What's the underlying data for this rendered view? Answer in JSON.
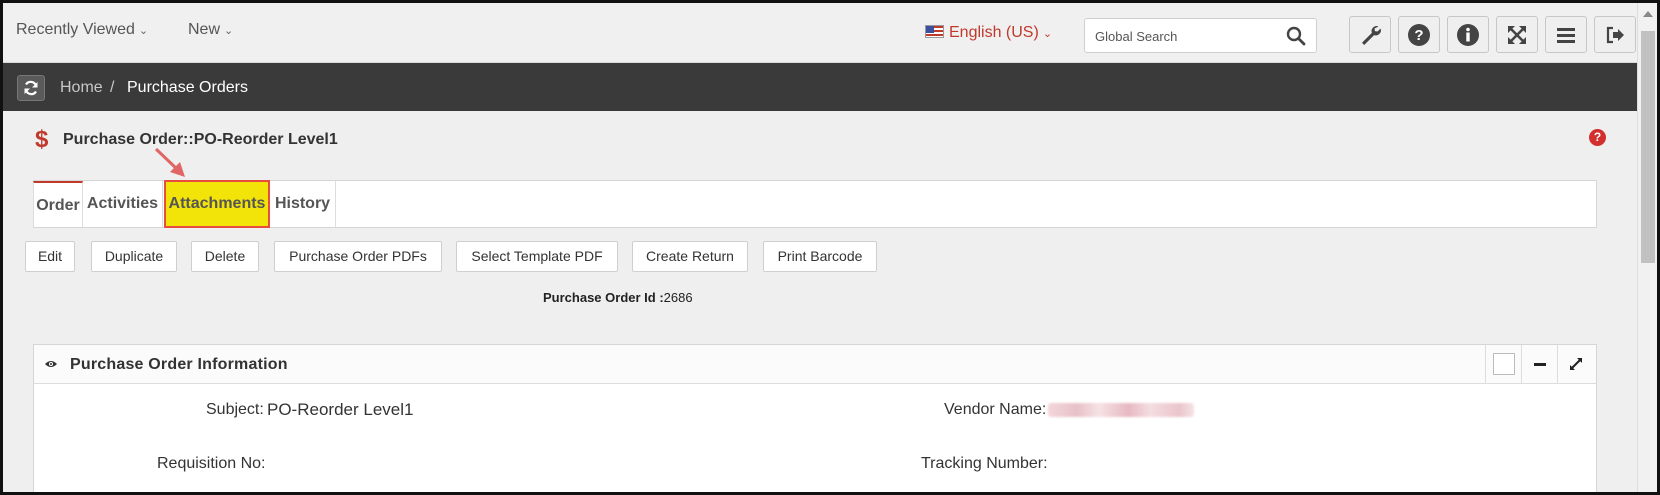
{
  "topbar": {
    "recently_viewed": "Recently Viewed",
    "new": "New",
    "language": "English (US)",
    "search_placeholder": "Global Search"
  },
  "breadcrumb": {
    "home": "Home",
    "separator": "/",
    "current": "Purchase Orders"
  },
  "page": {
    "title": "Purchase Order::PO-Reorder Level1",
    "help": "?"
  },
  "tabs": [
    {
      "label": "Order"
    },
    {
      "label": "Activities"
    },
    {
      "label": "Attachments"
    },
    {
      "label": "History"
    }
  ],
  "actions": {
    "edit": "Edit",
    "duplicate": "Duplicate",
    "delete": "Delete",
    "po_pdfs": "Purchase Order PDFs",
    "select_template": "Select Template PDF",
    "create_return": "Create Return",
    "print_barcode": "Print Barcode"
  },
  "po_id": {
    "label": "Purchase Order Id :",
    "value": "2686"
  },
  "panel": {
    "title": "Purchase Order Information",
    "fields": {
      "subject_label": "Subject:",
      "subject_value": "PO-Reorder Level1",
      "vendor_label": "Vendor Name:",
      "requisition_label": "Requisition No:",
      "tracking_label": "Tracking Number:"
    }
  },
  "colors": {
    "accent": "#c0392b",
    "highlight": "#f2e408",
    "breadcrumb_bar": "#3a3a3a"
  }
}
